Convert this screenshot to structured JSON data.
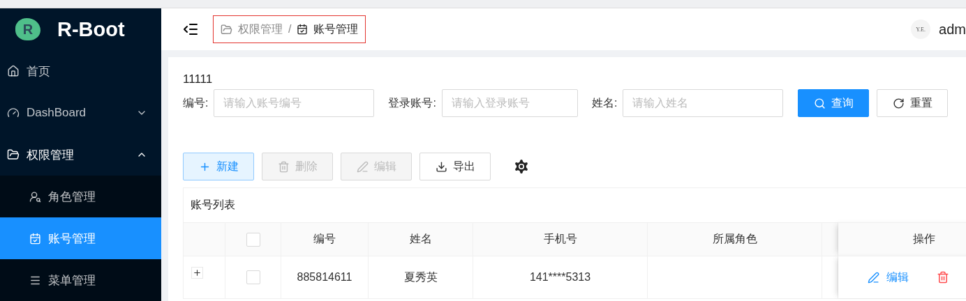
{
  "logo": {
    "mark": "R",
    "title": "R-Boot"
  },
  "sidebar": {
    "items": [
      {
        "label": "首页",
        "selected": false
      },
      {
        "label": "DashBoard",
        "selected": false,
        "expanded": false
      },
      {
        "label": "权限管理",
        "selected": false,
        "expanded": true,
        "children": [
          {
            "label": "角色管理",
            "selected": false
          },
          {
            "label": "账号管理",
            "selected": true
          },
          {
            "label": "菜单管理",
            "selected": false
          }
        ]
      }
    ]
  },
  "header": {
    "breadcrumb": [
      "权限管理",
      "账号管理"
    ],
    "separator": "/",
    "avatar": "Y.E.",
    "user": "adm"
  },
  "page_code": "11111",
  "filters": [
    {
      "label": "编号:",
      "placeholder": "请输入账号编号"
    },
    {
      "label": "登录账号:",
      "placeholder": "请输入登录账号"
    },
    {
      "label": "姓名:",
      "placeholder": "请输入姓名"
    }
  ],
  "filter_buttons": [
    {
      "label": "查询",
      "kind": "primary"
    },
    {
      "label": "重置",
      "kind": "default"
    }
  ],
  "toolbar": [
    {
      "label": "新建",
      "kind": "light",
      "disabled": false
    },
    {
      "label": "删除",
      "kind": "default",
      "disabled": true
    },
    {
      "label": "编辑",
      "kind": "default",
      "disabled": true
    },
    {
      "label": "导出",
      "kind": "default",
      "disabled": false
    }
  ],
  "table": {
    "title": "账号列表",
    "select_all": {
      "checked": false
    },
    "columns": [
      "编号",
      "姓名",
      "手机号",
      "所属角色",
      "操作"
    ],
    "rows": [
      {
        "expanded": false,
        "checked": false,
        "cells": [
          "885814611",
          "夏秀英",
          "141****5313",
          ""
        ],
        "actions": [
          "编辑"
        ]
      }
    ]
  }
}
